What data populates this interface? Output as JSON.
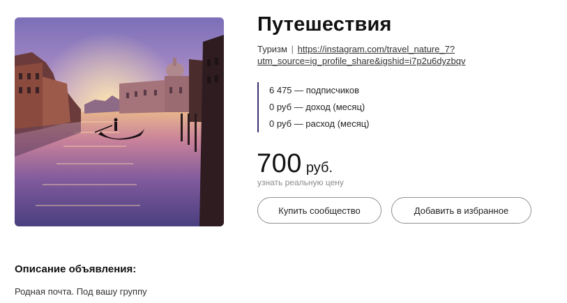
{
  "listing": {
    "title": "Путешествия",
    "category": "Туризм",
    "separator": "|",
    "url_line1": "https://instagram.com/travel_nature_7?",
    "url_line2": "utm_source=ig_profile_share&igshid=i7p2u6dyzbqv",
    "image_alt": "Venice canal with gondola at sunset"
  },
  "stats": [
    {
      "label": "6 475 — подписчиков"
    },
    {
      "label": "0 руб — доход (месяц)"
    },
    {
      "label": "0 руб — расход (месяц)"
    }
  ],
  "price": {
    "amount": "700",
    "currency": "руб.",
    "real_price_link": "узнать реальную цену"
  },
  "buttons": {
    "buy": "Купить сообщество",
    "favorite": "Добавить в избранное"
  },
  "description": {
    "heading": "Описание объявления:",
    "text": "Родная почта. Под вашу группу"
  },
  "colors": {
    "stats_border": "#3a2f72",
    "button_border": "#8f8f8f",
    "muted_text": "#8a8a8a"
  }
}
